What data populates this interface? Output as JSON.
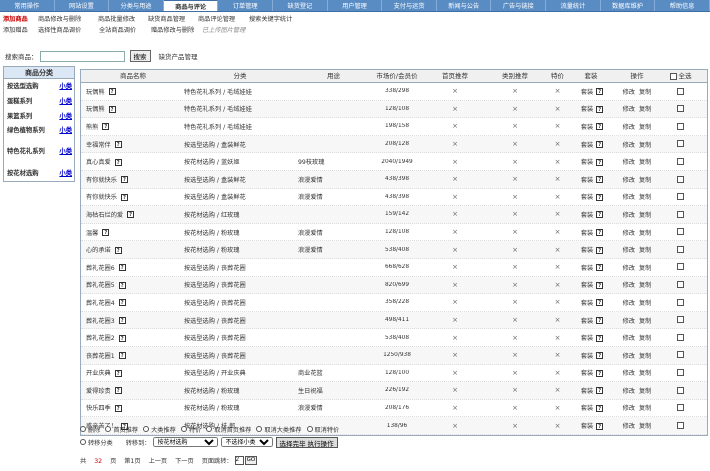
{
  "topnav": [
    "常用操作",
    "网站设置",
    "分类与用途",
    "商品与评论",
    "订单管理",
    "缺货登记",
    "用户管理",
    "支付与运货",
    "新闻与公告",
    "广告与链接",
    "流量统计",
    "数据库维护",
    "帮助信息"
  ],
  "topnav_active": 3,
  "subnav_row1": [
    "添加商品",
    "商品修改与删除",
    "商品批量修改",
    "缺货商品管理",
    "商品评论管理",
    "搜索关键字统计"
  ],
  "subnav_row2": [
    "添加赠品",
    "选择性商品调价",
    "全站商品调价",
    "赠品修改与删除",
    "已上传图片管理"
  ],
  "search": {
    "label": "搜索商品：",
    "button": "搜索",
    "shortage_link": "缺货产品管理"
  },
  "categories": {
    "title": "商品分类",
    "items": [
      {
        "name": "按选型选购",
        "sub": "小类"
      },
      {
        "name": "蛋糕系列",
        "sub": "小类"
      },
      {
        "name": "果篮系列",
        "sub": "小类"
      },
      {
        "name": "绿色植物系列",
        "sub": "小类"
      },
      {
        "name": "特色花礼系列",
        "sub": "小类"
      },
      {
        "name": "按花材选购",
        "sub": "小类"
      }
    ]
  },
  "table": {
    "headers": [
      "商品名称",
      "分类",
      "用途",
      "市场价/会员价",
      "首页推荐",
      "类别推荐",
      "特价",
      "套装",
      "操作",
      "全选"
    ],
    "set_label": "套装",
    "edit_label": "修改",
    "copy_label": "复制",
    "no_mark": "×",
    "rows": [
      {
        "name": "玩偶熊",
        "cat": "特色花礼系列 / 毛绒娃娃",
        "use": "",
        "price": "338/298"
      },
      {
        "name": "玩偶熊",
        "cat": "特色花礼系列 / 毛绒娃娃",
        "use": "",
        "price": "128/108"
      },
      {
        "name": "熊熊",
        "cat": "特色花礼系列 / 毛绒娃娃",
        "use": "",
        "price": "198/158"
      },
      {
        "name": "幸福常伴",
        "cat": "按选型选购 / 盒装鲜花",
        "use": "",
        "price": "208/128"
      },
      {
        "name": "真心真爱",
        "cat": "按花材选购 / 蓝妖姬",
        "use": "99枝玫瑰",
        "price": "2040/1949"
      },
      {
        "name": "有你就快乐",
        "cat": "按选型选购 / 盒装鲜花",
        "use": "浪漫爱情",
        "price": "438/398"
      },
      {
        "name": "有你就快乐",
        "cat": "按选型选购 / 盒装鲜花",
        "use": "浪漫爱情",
        "price": "438/398"
      },
      {
        "name": "海枯石烂的爱",
        "cat": "按花材选购 / 红玫瑰",
        "use": "",
        "price": "159/142"
      },
      {
        "name": "温馨",
        "cat": "按花材选购 / 粉玫瑰",
        "use": "浪漫爱情",
        "price": "128/108"
      },
      {
        "name": "心的承诺",
        "cat": "按花材选购 / 粉玫瑰",
        "use": "浪漫爱情",
        "price": "538/408"
      },
      {
        "name": "葬礼花圈6",
        "cat": "按选型选购 / 丧葬花圈",
        "use": "",
        "price": "668/628"
      },
      {
        "name": "葬礼花圈5",
        "cat": "按选型选购 / 丧葬花圈",
        "use": "",
        "price": "820/699"
      },
      {
        "name": "葬礼花圈4",
        "cat": "按选型选购 / 丧葬花圈",
        "use": "",
        "price": "358/228"
      },
      {
        "name": "葬礼花圈3",
        "cat": "按选型选购 / 丧葬花圈",
        "use": "",
        "price": "498/411"
      },
      {
        "name": "葬礼花圈2",
        "cat": "按选型选购 / 丧葬花圈",
        "use": "",
        "price": "538/408"
      },
      {
        "name": "丧葬花圈1",
        "cat": "按选型选购 / 丧葬花圈",
        "use": "",
        "price": "1250/938"
      },
      {
        "name": "开业庆典",
        "cat": "按选型选购 / 开业庆典",
        "use": "商业花篮",
        "price": "128/100"
      },
      {
        "name": "爱得珍贵",
        "cat": "按花材选购 / 粉玫瑰",
        "use": "生日祝福",
        "price": "226/192"
      },
      {
        "name": "快乐四季",
        "cat": "按花材选购 / 粉玫瑰",
        "use": "浪漫爱情",
        "price": "208/176"
      },
      {
        "name": "惑辛苦了！",
        "cat": "按花材选购 / 扶 郎",
        "use": "",
        "price": "138/96"
      }
    ]
  },
  "actions": {
    "radios1": [
      "删除",
      "首页推荐",
      "大类推荐",
      "特价",
      "取消首页推荐",
      "取消大类推荐",
      "取消特价"
    ],
    "radio_transfer": "转移分类",
    "transfer_label": "转移到：",
    "select1": "按花材选购",
    "select2": "不选择小类",
    "submit": "选择完毕  执行操作"
  },
  "pager": {
    "total_prefix": "共",
    "total": "32",
    "total_suffix": "页",
    "current": "第1页",
    "prev": "上一页",
    "next": "下一页",
    "jump_label": "页面跳转：",
    "jump_value": "2",
    "go": "GO"
  }
}
